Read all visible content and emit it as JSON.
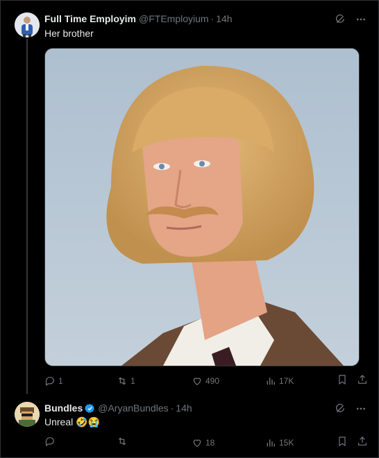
{
  "tweets": [
    {
      "display_name": "Full Time Employim",
      "handle": "@FTEmployium",
      "separator": "·",
      "time": "14h",
      "text": "Her brother",
      "has_media": true,
      "stats": {
        "replies": "1",
        "reposts": "1",
        "likes": "490",
        "views": "17K"
      }
    },
    {
      "display_name": "Bundles",
      "handle": "@AryanBundles",
      "separator": "·",
      "time": "14h",
      "text": "Unreal 🤣😭",
      "verified": true,
      "stats": {
        "replies": "",
        "reposts": "",
        "likes": "18",
        "views": "15K"
      }
    }
  ],
  "icons": {
    "grok": "grok-icon",
    "more": "more-icon",
    "reply": "reply-icon",
    "repost": "repost-icon",
    "like": "heart-icon",
    "views": "views-icon",
    "bookmark": "bookmark-icon",
    "share": "share-icon"
  },
  "colors": {
    "background": "#000000",
    "text": "#e7e9ea",
    "secondary": "#71767b",
    "border": "#2f3336",
    "verified": "#1d9bf0"
  }
}
